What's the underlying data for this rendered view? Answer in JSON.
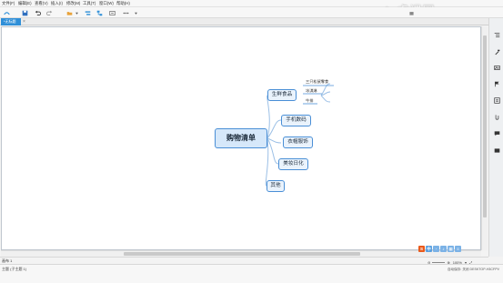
{
  "menu": [
    "文件(F)",
    "编辑(E)",
    "查看(V)",
    "插入(I)",
    "修改(M)",
    "工具(T)",
    "窗口(W)",
    "帮助(H)"
  ],
  "tab": {
    "label": "*无标题",
    "close": "×"
  },
  "watermark": "虎课网",
  "mindmap": {
    "root": "购物清单",
    "branches": [
      "生鲜食品",
      "手机数码",
      "衣帽服饰",
      "美妆日化",
      "其他"
    ],
    "leaves": [
      "三只松鼠零食",
      "冰淇淋",
      "牛排"
    ]
  },
  "sheet_tab": "画布 1",
  "status": {
    "left": "主题 (子主题 1)",
    "right": "自动保存: 关闭   DESKTOP-H3CFPV",
    "zoom": "100%"
  },
  "accent": "#2f8fd8"
}
